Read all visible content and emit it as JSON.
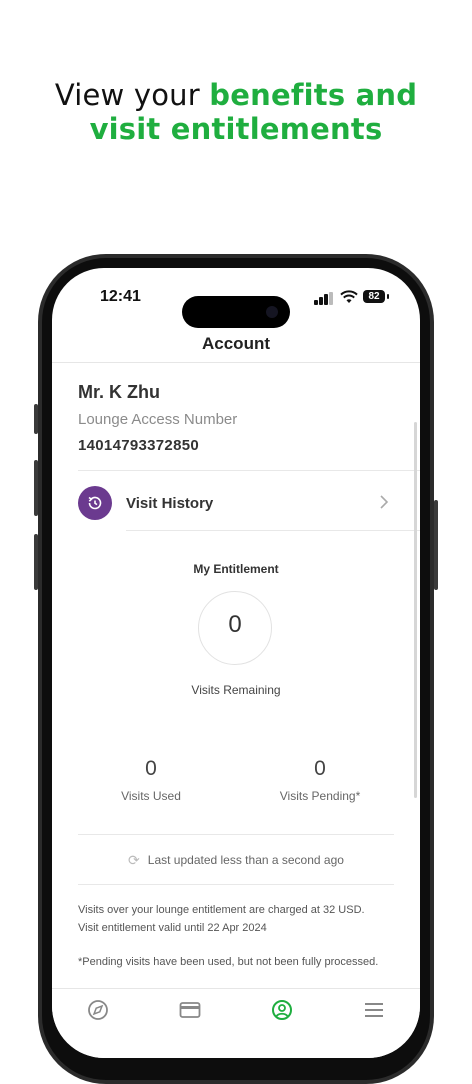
{
  "headline": {
    "line1_prefix": "View your",
    "line1_highlight": "benefits and",
    "line2_highlight": "visit entitlements",
    "highlight_color": "#1fae3f"
  },
  "status_bar": {
    "time": "12:41",
    "battery": "82",
    "icons": [
      "signal-icon",
      "wifi-icon",
      "battery-icon"
    ]
  },
  "nav": {
    "title": "Account"
  },
  "account": {
    "name": "Mr. K Zhu",
    "lounge_access_label": "Lounge Access Number",
    "lounge_access_number": "14014793372850"
  },
  "visit_history": {
    "label": "Visit History",
    "icon": "history-icon",
    "icon_color": "#6b3a8f"
  },
  "entitlement": {
    "title": "My Entitlement",
    "remaining_value": "0",
    "remaining_label": "Visits Remaining",
    "used_value": "0",
    "used_label": "Visits Used",
    "pending_value": "0",
    "pending_label": "Visits Pending*"
  },
  "last_updated": "Last updated less than a second ago",
  "notes": {
    "charge_line": "Visits over your lounge entitlement are charged at 32 USD.",
    "valid_line": "Visit entitlement valid until 22 Apr 2024",
    "pending_note": "*Pending visits have been used, but not been fully processed."
  },
  "tab_bar": {
    "tabs": [
      {
        "icon": "compass-icon",
        "active": false
      },
      {
        "icon": "card-icon",
        "active": false
      },
      {
        "icon": "account-icon",
        "active": true
      },
      {
        "icon": "menu-icon",
        "active": false
      }
    ],
    "active_color": "#1fae3f"
  }
}
